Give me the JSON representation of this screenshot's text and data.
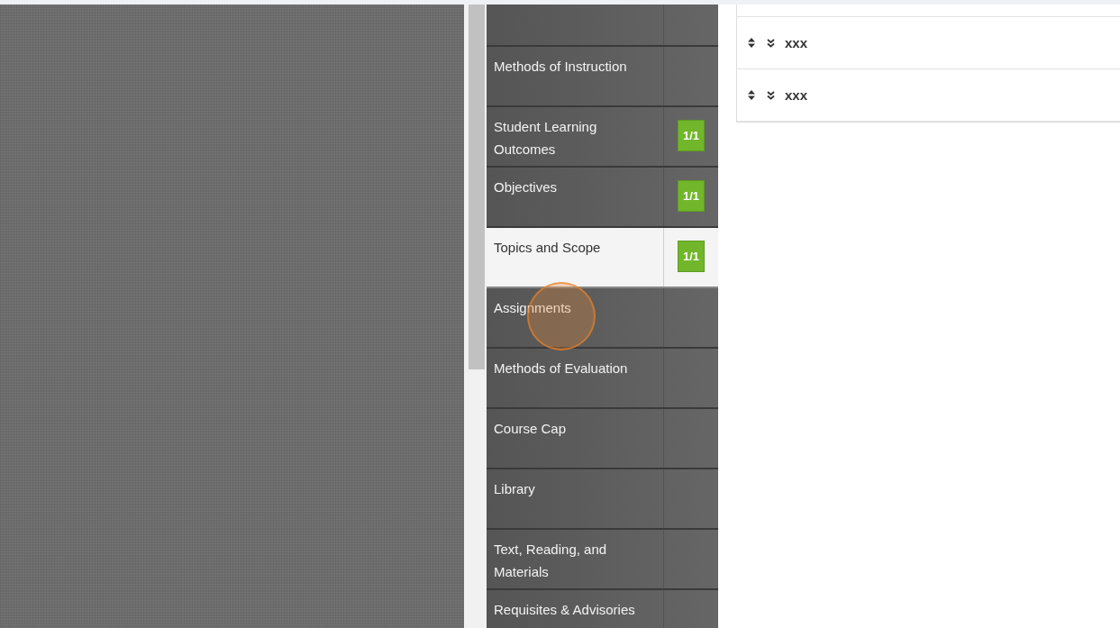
{
  "nav": {
    "items": [
      {
        "selected": false
      },
      {
        "label": "Methods of Instruction",
        "selected": false
      },
      {
        "label": "Student Learning Outcomes",
        "selected": false,
        "badge": "1/1"
      },
      {
        "label": "Objectives",
        "selected": false,
        "badge": "1/1"
      },
      {
        "label": "Topics and Scope",
        "selected": true,
        "badge": "1/1"
      },
      {
        "label": "Assignments",
        "selected": false
      },
      {
        "label": "Methods of Evaluation",
        "selected": false
      },
      {
        "label": "Course Cap",
        "selected": false
      },
      {
        "label": "Library",
        "selected": false
      },
      {
        "label": "Text, Reading, and Materials",
        "selected": false
      },
      {
        "label": "Requisites & Advisories",
        "selected": false
      }
    ]
  },
  "list": {
    "rows": [
      {
        "label": "xxx"
      },
      {
        "label": "xxx"
      }
    ]
  }
}
